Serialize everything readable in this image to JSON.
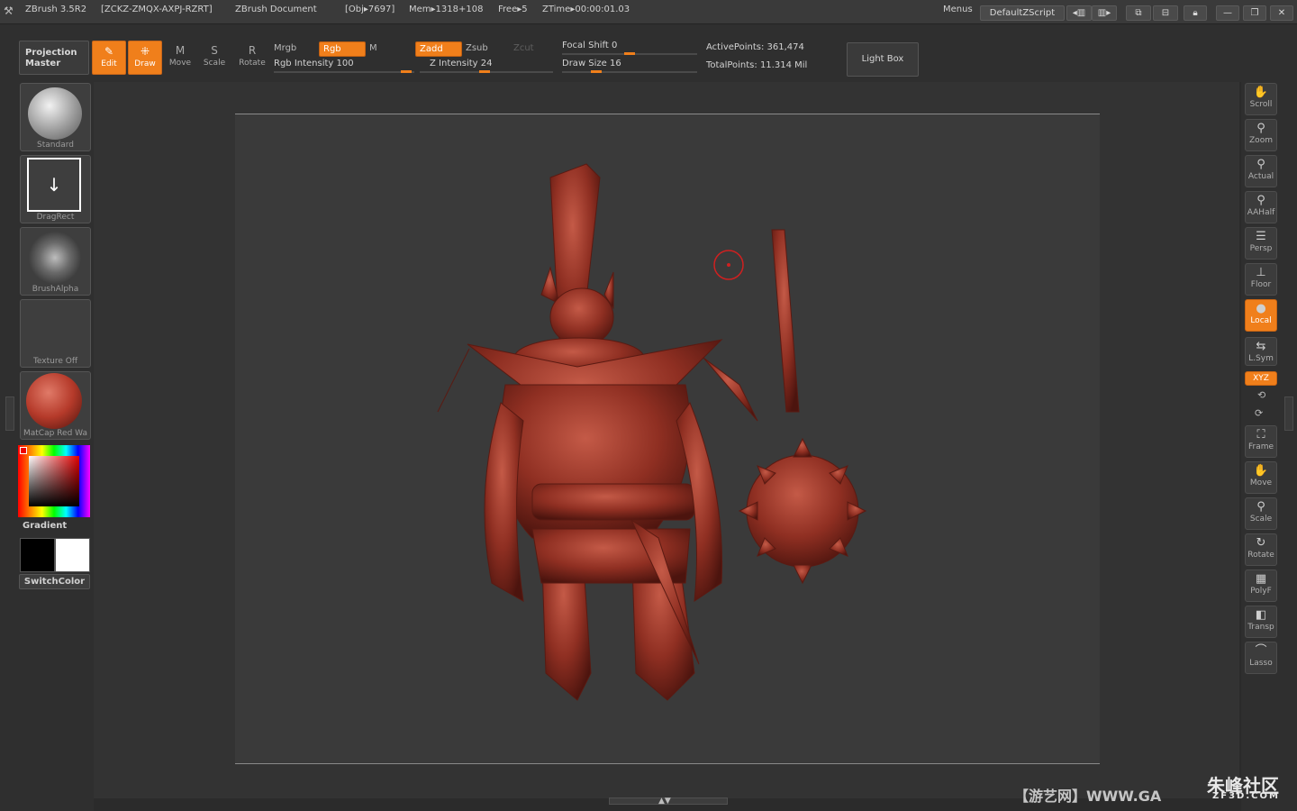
{
  "title": {
    "app": "ZBrush 3.5R2",
    "serial": "[ZCKZ-ZMQX-AXPJ-RZRT]",
    "doc": "ZBrush Document",
    "obj": "[Obj▸7697]",
    "mem": "Mem▸1318+108",
    "free": "Free▸5",
    "ztime": "ZTime▸00:00:01.03",
    "menus": "Menus",
    "script": "DefaultZScript"
  },
  "toolbar": {
    "projection_master": "Projection Master",
    "tools": [
      {
        "label": "Edit",
        "icon": "edit-icon",
        "active": true
      },
      {
        "label": "Draw",
        "icon": "draw-icon",
        "active": true
      },
      {
        "label": "Move",
        "icon": "move-icon",
        "active": false
      },
      {
        "label": "Scale",
        "icon": "scale-icon",
        "active": false
      },
      {
        "label": "Rotate",
        "icon": "rotate-icon",
        "active": false
      }
    ],
    "mrgb": "Mrgb",
    "rgb": "Rgb",
    "m": "M",
    "rgb_intensity": "Rgb Intensity 100",
    "zadd": "Zadd",
    "zsub": "Zsub",
    "zcut": "Zcut",
    "z_intensity": "Z Intensity 24",
    "focal_shift": "Focal Shift 0",
    "draw_size": "Draw Size 16",
    "active_points": "ActivePoints: 361,474",
    "total_points": "TotalPoints: 11.314 Mil",
    "light_box": "Light Box",
    "rgb_intensity_value": 100,
    "z_intensity_value": 24,
    "focal_shift_value": 0,
    "draw_size_value": 16
  },
  "left_shelf": {
    "standard": "Standard",
    "dragrect": "DragRect",
    "brushalpha": "BrushAlpha",
    "texture": "Texture Off",
    "matcap": "MatCap Red Wa",
    "gradient": "Gradient",
    "switchcolor": "SwitchColor",
    "colors": {
      "main": "#000000",
      "secondary": "#ffffff",
      "matcap": "#b53a2a"
    }
  },
  "right_shelf": [
    {
      "label": "Scroll",
      "icon": "scroll-icon"
    },
    {
      "label": "Zoom",
      "icon": "zoom-icon"
    },
    {
      "label": "Actual",
      "icon": "actual-icon"
    },
    {
      "label": "AAHalf",
      "icon": "aahalf-icon"
    },
    {
      "label": "Persp",
      "icon": "persp-icon"
    },
    {
      "label": "Floor",
      "icon": "floor-icon"
    },
    {
      "label": "Local",
      "icon": "local-icon",
      "active": true
    },
    {
      "label": "L.Sym",
      "icon": "lsym-icon"
    },
    {
      "label": "XYZ",
      "icon": "xyz-icon",
      "active": true
    },
    {
      "label": "Frame",
      "icon": "frame-icon"
    },
    {
      "label": "Move",
      "icon": "move-icon"
    },
    {
      "label": "Scale",
      "icon": "scale-icon"
    },
    {
      "label": "Rotate",
      "icon": "rotate-icon"
    },
    {
      "label": "PolyF",
      "icon": "polyf-icon"
    },
    {
      "label": "Transp",
      "icon": "transp-icon"
    },
    {
      "label": "Lasso",
      "icon": "lasso-icon"
    }
  ],
  "watermark": {
    "left": "【游艺网】WWW.GA",
    "brand": "朱峰社区",
    "domain": "ZF3D.COM"
  },
  "accent": "#f07f1b"
}
